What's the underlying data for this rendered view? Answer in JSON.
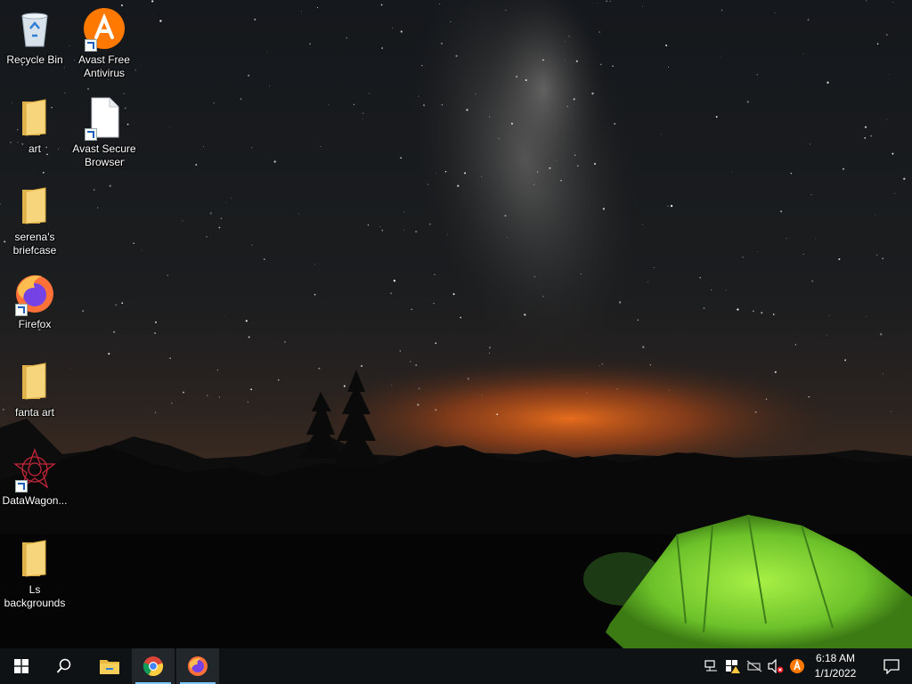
{
  "desktop": {
    "icons": [
      {
        "label": "Recycle Bin",
        "icon": "recycle-bin-icon"
      },
      {
        "label": "Avast Free Antivirus",
        "icon": "avast-icon"
      },
      {
        "label": "art",
        "icon": "folder-icon"
      },
      {
        "label": "Avast Secure Browser",
        "icon": "file-icon"
      },
      {
        "label": "serena's briefcase",
        "icon": "folder-icon"
      },
      {
        "label": "Firefox",
        "icon": "firefox-icon"
      },
      {
        "label": "fanta art",
        "icon": "folder-icon"
      },
      {
        "label": "DataWagon...",
        "icon": "datawagon-icon"
      },
      {
        "label": "Ls backgrounds",
        "icon": "folder-icon"
      }
    ]
  },
  "taskbar": {
    "buttons": [
      {
        "name": "start",
        "icon": "windows-logo-icon"
      },
      {
        "name": "search",
        "icon": "search-icon"
      },
      {
        "name": "file-explorer",
        "icon": "folder-icon"
      },
      {
        "name": "chrome",
        "icon": "chrome-icon"
      },
      {
        "name": "firefox",
        "icon": "firefox-icon",
        "active": true
      }
    ],
    "tray": {
      "icons": [
        "network-icon",
        "security-alert-icon",
        "no-network-icon",
        "volume-muted-icon",
        "avast-tray-icon"
      ],
      "time": "6:18 AM",
      "date": "1/1/2022",
      "notification_icon": "action-center-icon"
    }
  },
  "colors": {
    "taskbar": "#0f1214",
    "accent": "#7cc7ff",
    "tent": "#8fe33a",
    "glow": "#e0621b"
  }
}
